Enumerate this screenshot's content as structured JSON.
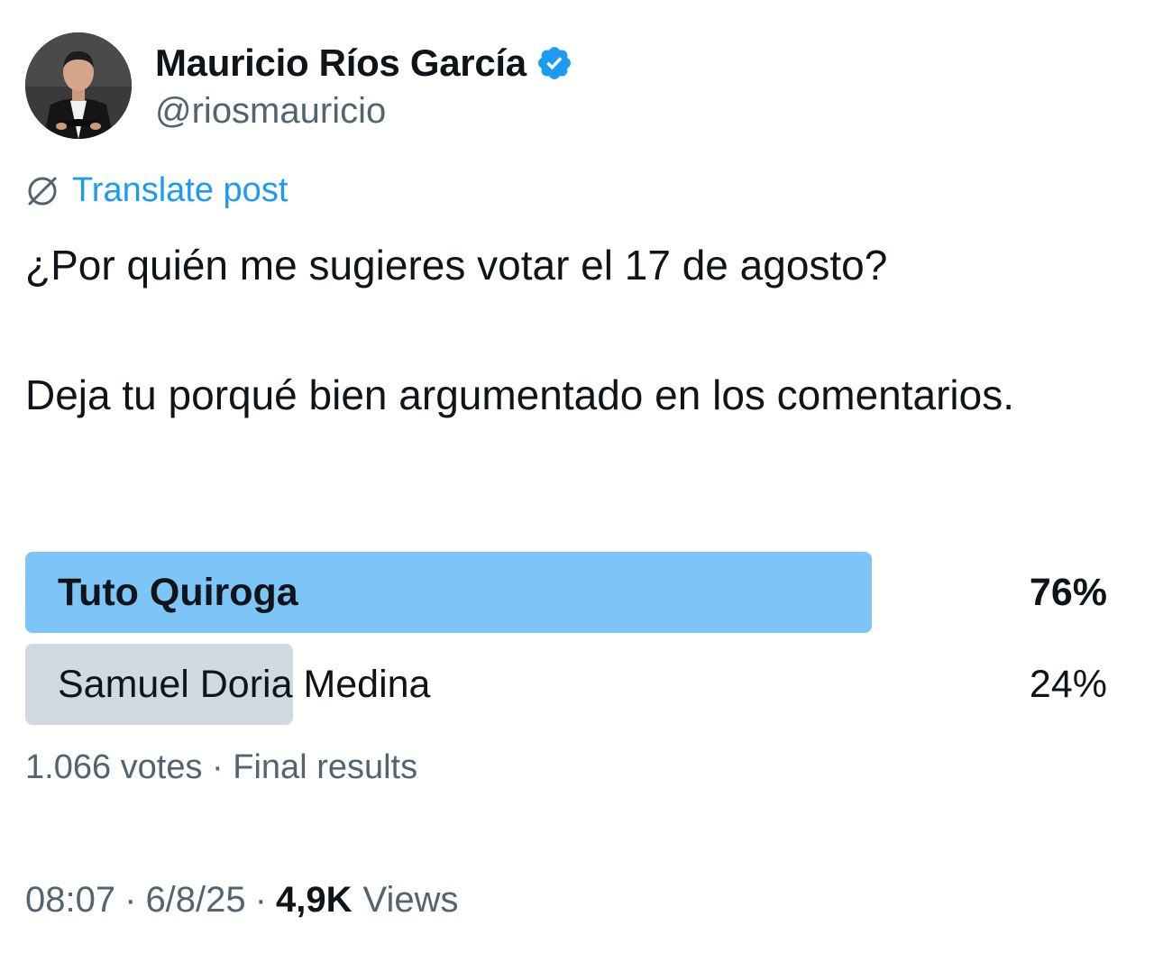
{
  "author": {
    "display_name": "Mauricio Ríos García",
    "handle": "@riosmauricio",
    "verified": true
  },
  "translate": {
    "label": "Translate post"
  },
  "post": {
    "line1": "¿Por quién me sugieres votar el 17 de agosto?",
    "line2": "Deja tu porqué bien argumentado en los comentarios."
  },
  "poll": {
    "options": [
      {
        "label": "Tuto Quiroga",
        "percent_text": "76%",
        "percent": 76,
        "winner": true
      },
      {
        "label": "Samuel Doria Medina",
        "percent_text": "24%",
        "percent": 24,
        "winner": false
      }
    ],
    "votes_text": "1.066 votes",
    "separator": "·",
    "status": "Final results"
  },
  "meta": {
    "time": "08:07",
    "date": "6/8/25",
    "views_count": "4,9K",
    "views_label": "Views",
    "separator": "·"
  },
  "colors": {
    "winner_bar": "#7cc5f6",
    "loser_bar": "#cfd9de",
    "accent": "#1d9bf0",
    "secondary_text": "#536471"
  },
  "icons": {
    "verified": "verified-badge-icon",
    "translate": "globe-translate-icon"
  }
}
